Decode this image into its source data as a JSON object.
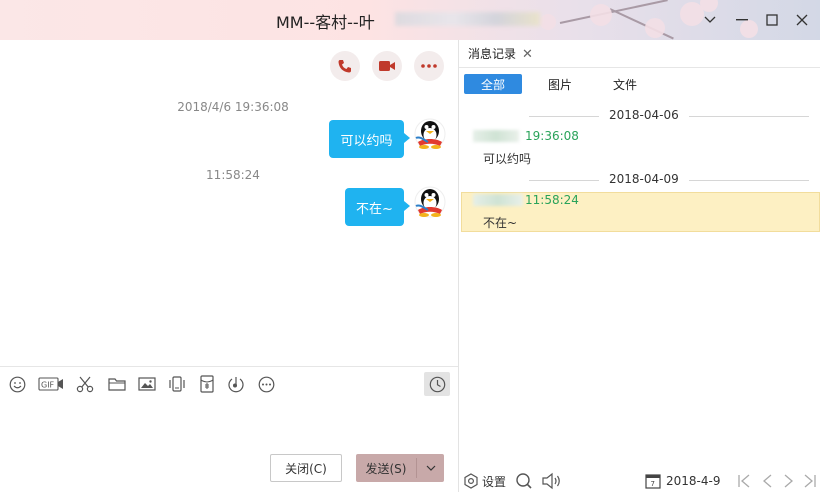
{
  "window": {
    "title": "MM--客村--叶",
    "controls": {
      "minimize": "minimize",
      "maximize": "maximize",
      "close": "close"
    }
  },
  "chat": {
    "header_actions": [
      "phone-icon",
      "video-icon",
      "more-icon"
    ],
    "messages": [
      {
        "timestamp": "2018/4/6 19:36:08",
        "text": "可以约吗"
      },
      {
        "timestamp": "11:58:24",
        "text": "不在~"
      }
    ],
    "toolbar_icons": [
      "emoji-icon",
      "gif-icon",
      "scissors-icon",
      "folder-icon",
      "image-icon",
      "shake-icon",
      "red-packet-icon",
      "music-icon",
      "more-icon",
      "clock-icon"
    ],
    "close_button": "关闭(C)",
    "send_button": "发送(S)"
  },
  "history": {
    "tab_label": "消息记录",
    "filters": [
      "全部",
      "图片",
      "文件"
    ],
    "active_filter": "全部",
    "groups": [
      {
        "date": "2018-04-06",
        "time": "19:36:08",
        "text": "可以约吗",
        "highlighted": false
      },
      {
        "date": "2018-04-09",
        "time": "11:58:24",
        "text": "不在~",
        "highlighted": true
      }
    ],
    "settings_label": "设置",
    "current_date": "2018-4-9"
  },
  "colors": {
    "bubble": "#1fb3f0",
    "filter_active": "#2f8ae0",
    "record_name": "#2aa35a",
    "highlight": "#fdf0c3",
    "send_button": "#c8a9a9"
  }
}
